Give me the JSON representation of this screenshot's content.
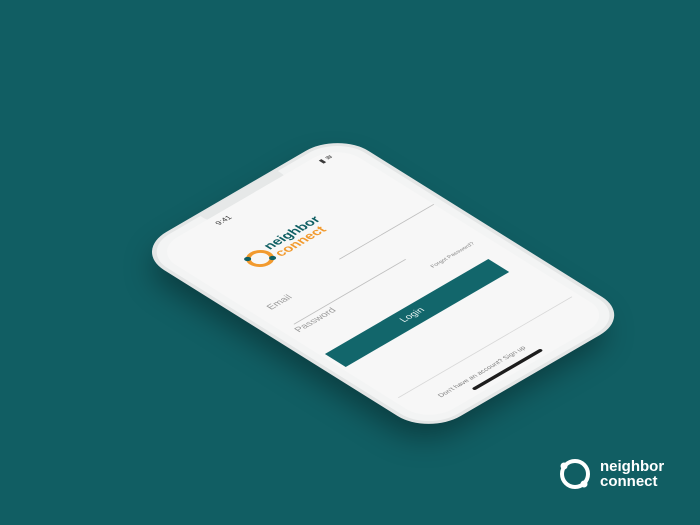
{
  "status": {
    "time": "9:41",
    "icons": "▮ ≋"
  },
  "logo": {
    "word1": "neighbor",
    "word2": "connect"
  },
  "form": {
    "email_placeholder": "Email",
    "password_placeholder": "Password",
    "forgot_label": "Forgot Password?",
    "login_label": "Login",
    "signup_text": "Don't have an account? Sign up"
  },
  "brand": {
    "word1": "neighbor",
    "word2": "connect"
  },
  "colors": {
    "background": "#115e63",
    "button": "#12666b",
    "logo_accent": "#f29a2e",
    "logo_primary": "#0f5f63"
  }
}
